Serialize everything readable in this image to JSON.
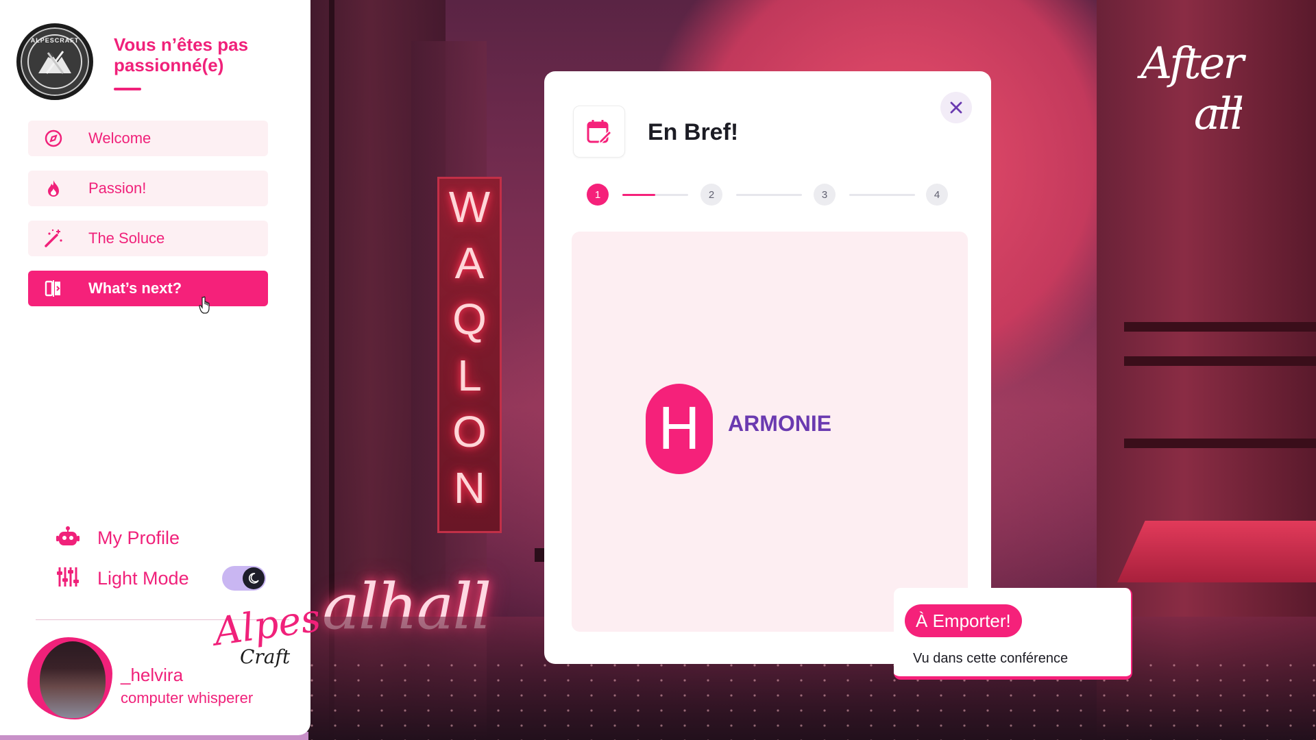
{
  "sidebar": {
    "logo_text": "ALPESCRAFT",
    "tagline": "Vous n’êtes pas passionné(e)",
    "items": [
      {
        "label": "Welcome",
        "icon": "compass-icon"
      },
      {
        "label": "Passion!",
        "icon": "flame-icon"
      },
      {
        "label": "The Soluce",
        "icon": "magic-wand-icon"
      },
      {
        "label": "What’s next?",
        "icon": "compare-icon",
        "active": true
      }
    ],
    "profile_label": "My Profile",
    "light_mode_label": "Light Mode",
    "light_mode_on": true,
    "user": {
      "name": "_helvira",
      "title": "computer whisperer"
    },
    "brand_script": "Alpes",
    "brand_craft": "Craft"
  },
  "background": {
    "neon_letters": [
      "W",
      "A",
      "Q",
      "L",
      "O",
      "N"
    ],
    "neon_script": "alhall"
  },
  "overlay_title": "After all",
  "modal": {
    "title": "En Bref!",
    "steps": [
      "1",
      "2",
      "3",
      "4"
    ],
    "current_step": 1,
    "step_progress": 0.5,
    "badge_letter": "H",
    "badge_text": "ARMONIE"
  },
  "toast": {
    "badge": "À Emporter!",
    "text": "Vu dans cette conférence"
  },
  "colors": {
    "accent": "#f5217a",
    "accent_text": "#f0217a",
    "purple": "#6a3ab0",
    "toggle_track": "#c9b6f2"
  }
}
